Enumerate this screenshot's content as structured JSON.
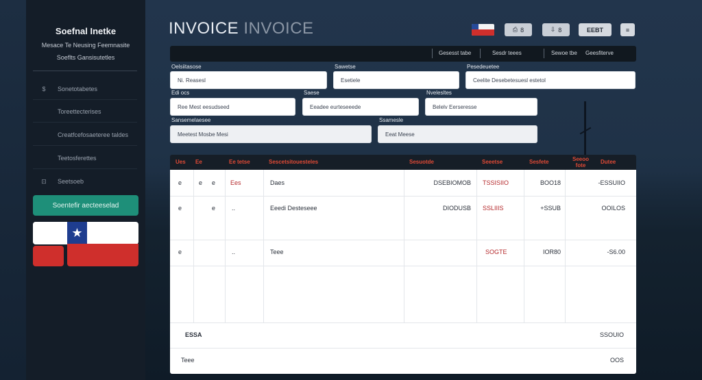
{
  "sidebar": {
    "brand": "Soefnal Inetke",
    "subtitle1": "Mesace Te Neusing Feemnasite",
    "subtitle2": "Soeflts Gansisutetles",
    "items": [
      {
        "icon": "$",
        "icon_name": "dollar-icon",
        "label": "Sonetotabetes"
      },
      {
        "icon": "",
        "icon_name": "list-icon",
        "label": "Toreettecterises"
      },
      {
        "icon": "",
        "icon_name": "document-icon",
        "label": "Creatfcefosaeteree taldes"
      },
      {
        "icon": "",
        "icon_name": "folder-icon",
        "label": "Teetosferettes"
      },
      {
        "icon": "⊡",
        "icon_name": "settings-icon",
        "label": "Seetsoeb"
      }
    ],
    "button": "Soentefir aecteeselad"
  },
  "header": {
    "title_primary": "INVOICE",
    "title_secondary": "INVOICE",
    "btn1_icon": "⎙",
    "btn1_label": "8",
    "btn2_icon": "⇩",
    "btn2_label": "8",
    "btn3_label": "EEBT",
    "btn4_label": "≡"
  },
  "toolbar": {
    "items": [
      "Gesesst tabe",
      "Sesdr teees",
      "Sewoe tbe",
      "Geesfiterve"
    ]
  },
  "form": {
    "row1": [
      {
        "label": "Oelsiitasose",
        "value": "Ni. Reasesl"
      },
      {
        "label": "Sawetse",
        "value": "Esetiele"
      },
      {
        "label": "Pesedeuetee",
        "value": "Ceelite Desebetesuesl estetol"
      }
    ],
    "row2": [
      {
        "label": "Edi ocs",
        "value": "Ree Mest eesudseed"
      },
      {
        "label": "Saese",
        "value": "Eeadee eurteseeede"
      },
      {
        "label": "Nvelesltes",
        "value": "Belelv Eerseresse"
      }
    ],
    "row3": [
      {
        "label": "Sansemelaesee",
        "value": "Meetest Mosbe Mesi"
      },
      {
        "label": "Ssamesle",
        "value": "Eeat Meese"
      }
    ]
  },
  "table": {
    "headers": [
      "Ues",
      "Ee",
      "Ee tetse",
      "Sescetsitouesteles",
      "Sesuotde",
      "Seeetse",
      "Sesfete",
      "Seeoo fote",
      "Dutee"
    ],
    "rows": [
      {
        "c1": "e",
        "c2": "e",
        "c3": "e",
        "c4": "Ees",
        "c5": "Daes",
        "c6": "DSEBIOMOB",
        "c7": "TSSISIIO",
        "c8": "BOO18",
        "c9": "-ESSUIIO"
      },
      {
        "c1": "e",
        "c2": "",
        "c3": "e",
        "c4": "..",
        "c5": "Eeedi Desteseee",
        "c6": "DIODUSB",
        "c7": "SSLIIIS",
        "c8": "+SSUB",
        "c9": "OOILOS"
      },
      {
        "c1": "e",
        "c2": "",
        "c3": "",
        "c4": "..",
        "c5": "Teee",
        "c6": "",
        "c7": "SOGTE",
        "c8": "IOR80",
        "c9": "-S6.00"
      }
    ]
  },
  "totals": [
    {
      "label": "ESSA",
      "value": "SSOUIO"
    },
    {
      "label": "Teee",
      "value": "OOS"
    }
  ],
  "colors": {
    "accent_button": "#1e8f79",
    "table_header_text": "#e04a35",
    "sidebar_bg": "#141d28",
    "flag_red": "#cf2f2c",
    "flag_blue": "#1e3d8f"
  }
}
